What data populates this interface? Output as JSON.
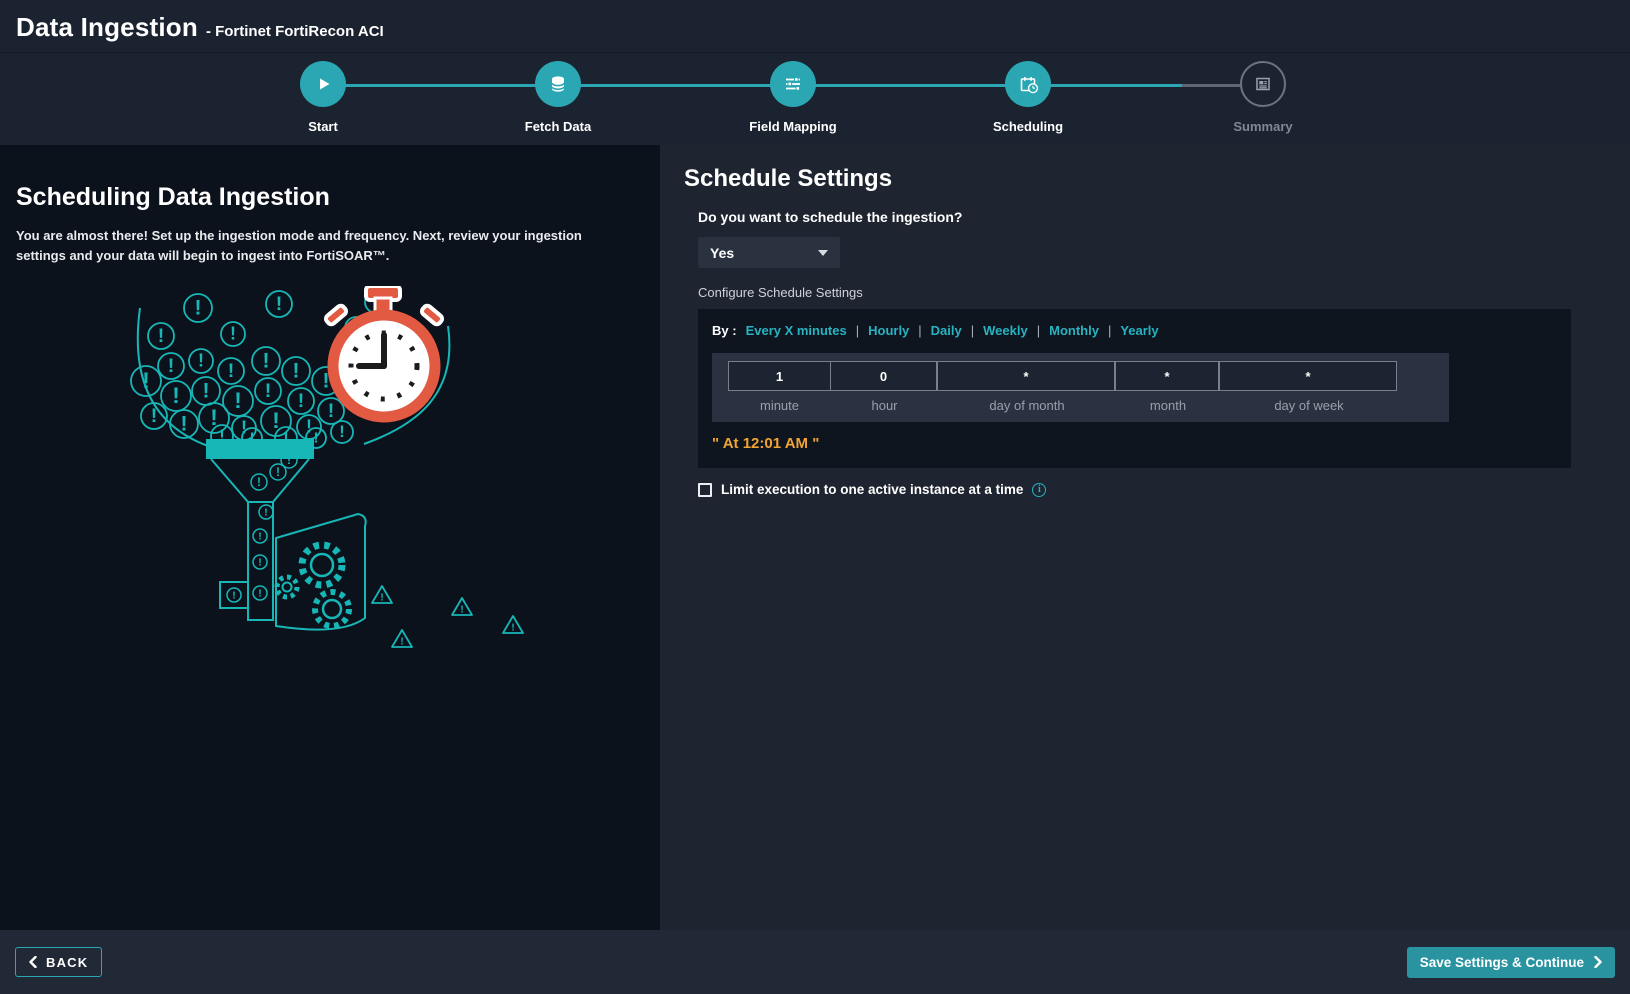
{
  "titlebar": {
    "title": "Data Ingestion",
    "subtitle": "- Fortinet FortiRecon ACI"
  },
  "stepper": {
    "steps": [
      {
        "label": "Start",
        "icon": "play-icon",
        "state": "complete"
      },
      {
        "label": "Fetch Data",
        "icon": "database-icon",
        "state": "complete"
      },
      {
        "label": "Field Mapping",
        "icon": "field-mapping-icon",
        "state": "complete"
      },
      {
        "label": "Scheduling",
        "icon": "calendar-clock-icon",
        "state": "active"
      },
      {
        "label": "Summary",
        "icon": "summary-doc-icon",
        "state": "upcoming"
      }
    ]
  },
  "left_panel": {
    "title": "Scheduling Data Ingestion",
    "description": "You are almost there! Set up the ingestion mode and frequency. Next, review your ingestion settings and your data will begin to ingest into FortiSOAR™."
  },
  "right_panel": {
    "title": "Schedule Settings",
    "schedule_question": "Do you want to schedule the ingestion?",
    "schedule_dropdown_value": "Yes",
    "configure_label": "Configure Schedule Settings",
    "by_label": "By :",
    "separator": "|",
    "frequency_options": [
      "Every X minutes",
      "Hourly",
      "Daily",
      "Weekly",
      "Monthly",
      "Yearly"
    ],
    "cron_fields": [
      {
        "value": "1",
        "label": "minute"
      },
      {
        "value": "0",
        "label": "hour"
      },
      {
        "value": "*",
        "label": "day of month"
      },
      {
        "value": "*",
        "label": "month"
      },
      {
        "value": "*",
        "label": "day of week"
      }
    ],
    "cron_description": "\" At 12:01 AM \"",
    "limit_checkbox_label": "Limit execution to one active instance at a time",
    "limit_checkbox_checked": false
  },
  "footer": {
    "back_label": "BACK",
    "save_label": "Save Settings & Continue"
  },
  "colors": {
    "accent_teal": "#2aa7b2",
    "link_teal": "#27b3c0",
    "cron_text_orange": "#f0a432",
    "stopwatch_orange": "#e25a41",
    "panel_dark": "#0c121c",
    "panel_light": "#1e2430"
  }
}
